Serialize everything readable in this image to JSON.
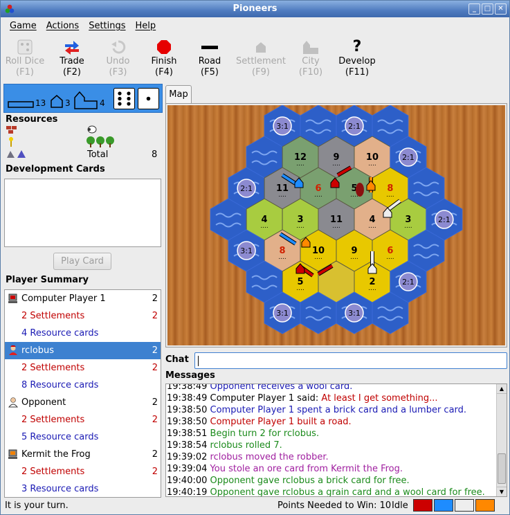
{
  "window": {
    "title": "Pioneers"
  },
  "menu": [
    "Game",
    "Actions",
    "Settings",
    "Help"
  ],
  "toolbar": [
    {
      "label": "Roll Dice",
      "key": "(F1)",
      "enabled": false,
      "icon": "dice-icon"
    },
    {
      "label": "Trade",
      "key": "(F2)",
      "enabled": true,
      "icon": "trade-icon"
    },
    {
      "label": "Undo",
      "key": "(F3)",
      "enabled": false,
      "icon": "undo-icon"
    },
    {
      "label": "Finish",
      "key": "(F4)",
      "enabled": true,
      "icon": "finish-icon"
    },
    {
      "label": "Road",
      "key": "(F5)",
      "enabled": true,
      "icon": "road-icon"
    },
    {
      "label": "Settlement",
      "key": "(F9)",
      "enabled": false,
      "icon": "settlement-icon"
    },
    {
      "label": "City",
      "key": "(F10)",
      "enabled": false,
      "icon": "city-icon"
    },
    {
      "label": "Develop",
      "key": "(F11)",
      "enabled": true,
      "icon": "develop-icon"
    }
  ],
  "pieces": {
    "roads": "13",
    "settlements": "3",
    "cities": "4"
  },
  "dice": {
    "die1": 6,
    "die2": 1
  },
  "resources": {
    "label": "Resources",
    "total_label": "Total",
    "total": "8"
  },
  "dev_cards": {
    "label": "Development Cards",
    "play_label": "Play Card"
  },
  "summary": {
    "label": "Player Summary",
    "rows": [
      {
        "text": "Computer Player 1",
        "count": "2",
        "kind": "player",
        "icon": "computer-player-icon",
        "color": "#000000"
      },
      {
        "text": "2 Settlements",
        "count": "2",
        "kind": "settle"
      },
      {
        "text": "4 Resource cards",
        "count": "",
        "kind": "res"
      },
      {
        "text": "rclobus",
        "count": "2",
        "kind": "player",
        "icon": "user-player-icon",
        "selected": true
      },
      {
        "text": "2 Settlements",
        "count": "2",
        "kind": "settle"
      },
      {
        "text": "8 Resource cards",
        "count": "",
        "kind": "res"
      },
      {
        "text": "Opponent",
        "count": "2",
        "kind": "player",
        "icon": "opponent-player-icon"
      },
      {
        "text": "2 Settlements",
        "count": "2",
        "kind": "settle"
      },
      {
        "text": "5 Resource cards",
        "count": "",
        "kind": "res"
      },
      {
        "text": "Kermit the Frog",
        "count": "2",
        "kind": "player",
        "icon": "computer-player-icon"
      },
      {
        "text": "2 Settlements",
        "count": "2",
        "kind": "settle"
      },
      {
        "text": "3 Resource cards",
        "count": "",
        "kind": "res"
      }
    ]
  },
  "map_tab": "Map",
  "chat_label": "Chat",
  "messages_label": "Messages",
  "messages": [
    {
      "time": "19:38:49",
      "text": "Opponent receives a wool card.",
      "color": "blue"
    },
    {
      "time": "19:38:49",
      "prefix": "Computer Player 1 said: ",
      "text": "At least I get something...",
      "color": "red"
    },
    {
      "time": "19:38:50",
      "text": "Computer Player 1 spent a brick card and a lumber card.",
      "color": "blue"
    },
    {
      "time": "19:38:50",
      "text": "Computer Player 1 built a road.",
      "color": "red"
    },
    {
      "time": "19:38:51",
      "text": "Begin turn 2 for rclobus.",
      "color": "green"
    },
    {
      "time": "19:38:54",
      "text": "rclobus rolled 7.",
      "color": "green"
    },
    {
      "time": "19:39:02",
      "text": "rclobus moved the robber.",
      "color": "purple"
    },
    {
      "time": "19:39:04",
      "text": "You stole an ore card from Kermit the Frog.",
      "color": "purple"
    },
    {
      "time": "19:40:00",
      "text": "Opponent gave rclobus a brick card for free.",
      "color": "green"
    },
    {
      "time": "19:40:19",
      "text": "Opponent gave rclobus a grain card and a wool card for free.",
      "color": "green"
    }
  ],
  "status": {
    "turn": "It is your turn.",
    "points": "Points Needed to Win: 10",
    "state": "Idle"
  },
  "player_colors": [
    "#cc0000",
    "#1e8cff",
    "#eeeeee",
    "#ff8800"
  ],
  "hexes": [
    {
      "col": 0,
      "row": 0,
      "type": "sea",
      "port": "3:1"
    },
    {
      "col": 1,
      "row": 0,
      "type": "sea"
    },
    {
      "col": 2,
      "row": 0,
      "type": "sea",
      "port": "2:1"
    },
    {
      "col": 3,
      "row": 0,
      "type": "sea"
    },
    {
      "col": 0,
      "row": 1,
      "type": "sea"
    },
    {
      "col": 1,
      "row": 1,
      "type": "forest",
      "num": "12"
    },
    {
      "col": 2,
      "row": 1,
      "type": "mountain",
      "num": "9"
    },
    {
      "col": 3,
      "row": 1,
      "type": "hill",
      "num": "10"
    },
    {
      "col": 4,
      "row": 1,
      "type": "sea",
      "port": "2:1"
    },
    {
      "col": 0,
      "row": 2,
      "type": "sea",
      "port": "2:1"
    },
    {
      "col": 1,
      "row": 2,
      "type": "mountain",
      "num": "11"
    },
    {
      "col": 2,
      "row": 2,
      "type": "forest",
      "num": "6"
    },
    {
      "col": 3,
      "row": 2,
      "type": "forest",
      "num": "5",
      "robber": true
    },
    {
      "col": 4,
      "row": 2,
      "type": "field",
      "num": "8"
    },
    {
      "col": 5,
      "row": 2,
      "type": "sea"
    },
    {
      "col": 0,
      "row": 3,
      "type": "sea"
    },
    {
      "col": 1,
      "row": 3,
      "type": "pasture",
      "num": "4"
    },
    {
      "col": 2,
      "row": 3,
      "type": "pasture",
      "num": "3"
    },
    {
      "col": 3,
      "row": 3,
      "type": "mountain",
      "num": "11"
    },
    {
      "col": 4,
      "row": 3,
      "type": "hill",
      "num": "4"
    },
    {
      "col": 5,
      "row": 3,
      "type": "pasture",
      "num": "3"
    },
    {
      "col": 6,
      "row": 3,
      "type": "sea",
      "port": "2:1"
    },
    {
      "col": 0,
      "row": 4,
      "type": "sea",
      "port": "3:1"
    },
    {
      "col": 1,
      "row": 4,
      "type": "hill",
      "num": "8"
    },
    {
      "col": 2,
      "row": 4,
      "type": "field",
      "num": "10"
    },
    {
      "col": 3,
      "row": 4,
      "type": "field",
      "num": "9"
    },
    {
      "col": 4,
      "row": 4,
      "type": "field",
      "num": "6"
    },
    {
      "col": 5,
      "row": 4,
      "type": "sea"
    },
    {
      "col": 0,
      "row": 5,
      "type": "sea"
    },
    {
      "col": 1,
      "row": 5,
      "type": "field",
      "num": "5"
    },
    {
      "col": 2,
      "row": 5,
      "type": "desert"
    },
    {
      "col": 3,
      "row": 5,
      "type": "field",
      "num": "2"
    },
    {
      "col": 4,
      "row": 5,
      "type": "sea",
      "port": "2:1"
    },
    {
      "col": 0,
      "row": 6,
      "type": "sea",
      "port": "3:1"
    },
    {
      "col": 1,
      "row": 6,
      "type": "sea"
    },
    {
      "col": 2,
      "row": 6,
      "type": "sea",
      "port": "3:1"
    },
    {
      "col": 3,
      "row": 6,
      "type": "sea"
    }
  ]
}
